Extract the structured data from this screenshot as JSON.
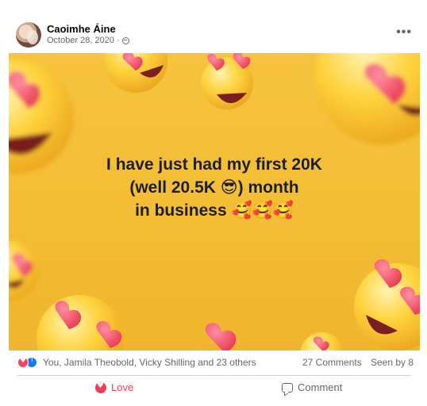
{
  "post": {
    "author": "Caoimhe Áine",
    "date": "October 28, 2020 ·",
    "more_label": "•••",
    "text_lines": [
      "I have just had my first 20K",
      "(well 20.5K 😎) month",
      "in business 🥰🥰🥰"
    ]
  },
  "stats": {
    "reactors": "You, Jamila Theobold, Vicky Shilling and 23 others",
    "comments": "27 Comments",
    "seen_by": "Seen by 8"
  },
  "actions": {
    "love_label": "Love",
    "comment_label": "Comment"
  },
  "colors": {
    "background_yellow": "#f4bf37",
    "love_red": "#f33e58",
    "like_blue": "#1877f2",
    "muted_text": "#65676b"
  },
  "icons": [
    "globe-icon",
    "more-icon",
    "love-reaction-icon",
    "like-reaction-icon",
    "love-icon",
    "comment-icon"
  ]
}
